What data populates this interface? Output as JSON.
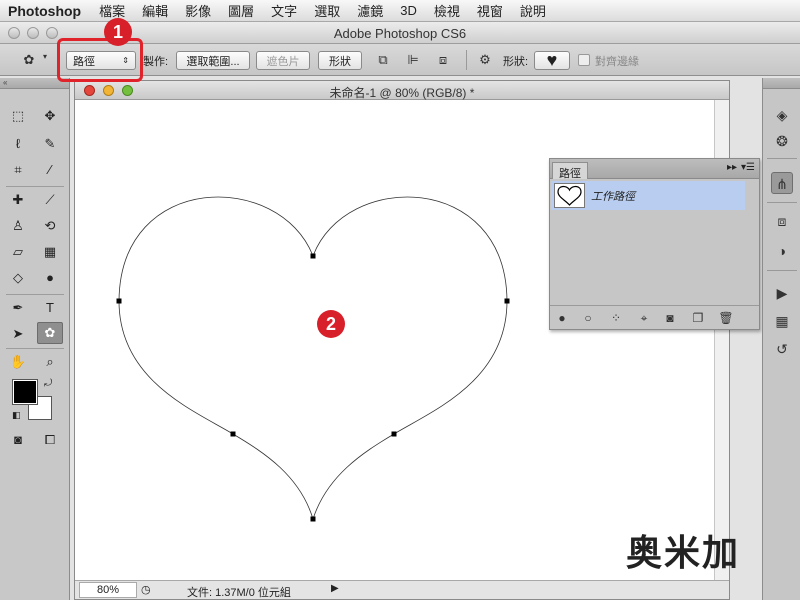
{
  "menubar": {
    "app": "Photoshop",
    "items": [
      "檔案",
      "編輯",
      "影像",
      "圖層",
      "文字",
      "選取",
      "濾鏡",
      "3D",
      "檢視",
      "視窗",
      "說明"
    ]
  },
  "window": {
    "title": "Adobe Photoshop CS6"
  },
  "options": {
    "mode_value": "路徑",
    "make_label": "製作:",
    "selection_button": "選取範圍...",
    "mask_button": "遮色片",
    "shape_button": "形狀",
    "shape_label": "形狀:",
    "align_edges_label": "對齊邊緣"
  },
  "document": {
    "title": "未命名-1 @ 80% (RGB/8) *",
    "zoom": "80%",
    "file_info": "文件: 1.37M/0 位元組"
  },
  "paths_panel": {
    "tab": "路徑",
    "row_label": "工作路徑"
  },
  "callouts": {
    "one": "1",
    "two": "2"
  },
  "watermark": {
    "text": "奥米加"
  },
  "colors": {
    "callout": "#d8202a",
    "selection": "#b8cdf0"
  }
}
